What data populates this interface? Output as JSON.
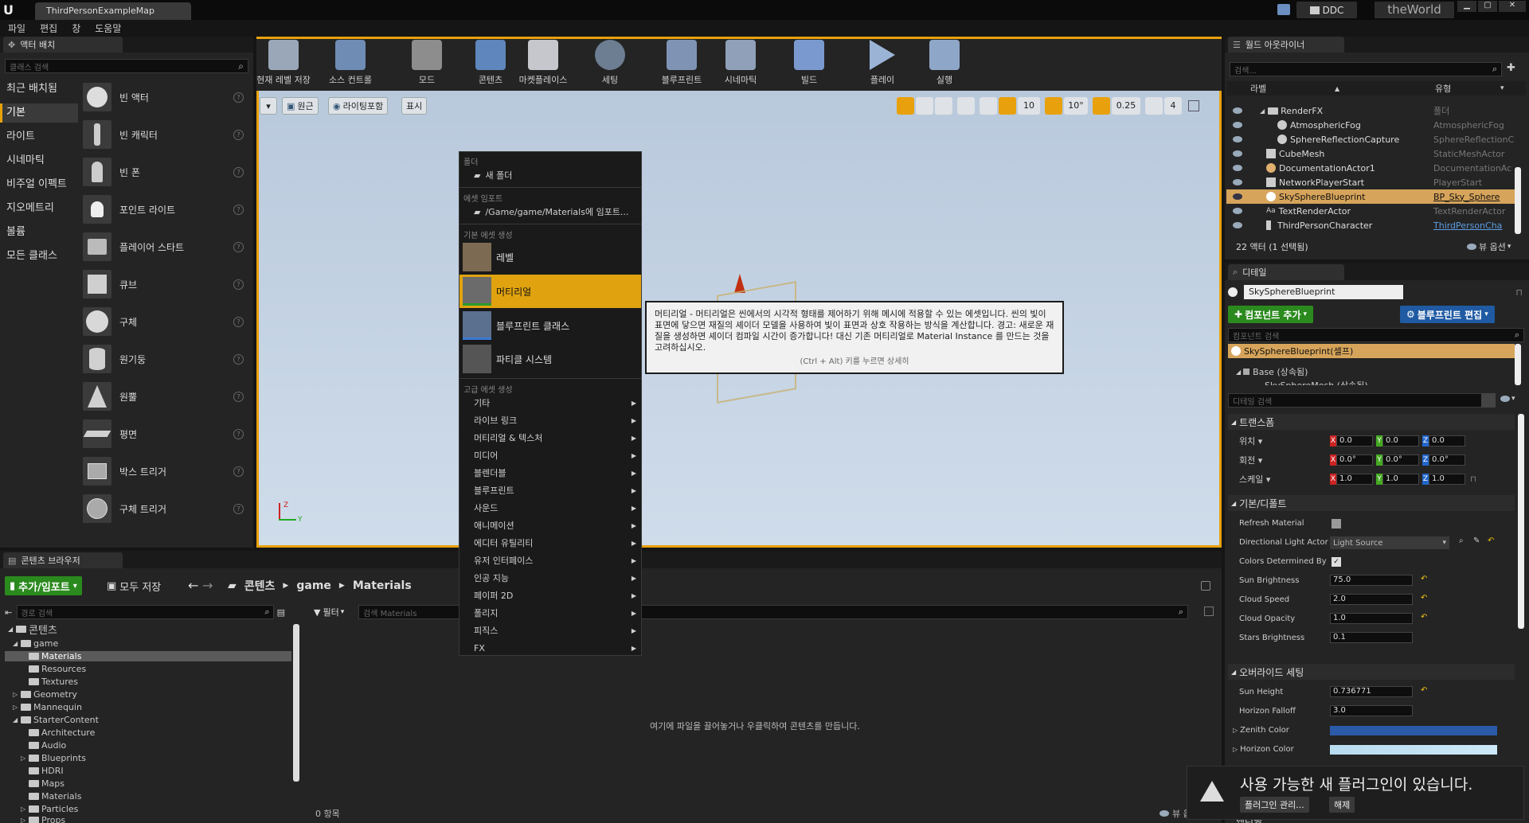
{
  "titlebar": {
    "tab_label": "ThirdPersonExampleMap",
    "ddc_label": "DDC",
    "world_label": "theWorld"
  },
  "menubar": [
    "파일",
    "편집",
    "창",
    "도움말"
  ],
  "place_panel": {
    "tab": "액터 배치",
    "search_placeholder": "클래스 검색",
    "categories": [
      "최근 배치됨",
      "기본",
      "라이트",
      "시네마틱",
      "비주얼 이펙트",
      "지오메트리",
      "볼륨",
      "모든 클래스"
    ],
    "selected_category": "기본",
    "items": [
      "빈 액터",
      "빈 캐릭터",
      "빈 폰",
      "포인트 라이트",
      "플레이어 스타트",
      "큐브",
      "구체",
      "원기둥",
      "원뿔",
      "평면",
      "박스 트리거",
      "구체 트리거"
    ],
    "help_glyph": "?"
  },
  "toolbar": {
    "buttons": [
      "현재 레벨 저장",
      "소스 컨트롤",
      "모드",
      "콘텐츠",
      "마켓플레이스",
      "세팅",
      "블루프린트",
      "시네마틱",
      "빌드",
      "플레이",
      "실행"
    ]
  },
  "viewport": {
    "chips": [
      "원근",
      "라이팅포함",
      "표시"
    ],
    "grid_snap": "10",
    "rot_snap": "10°",
    "scale_snap": "0.25",
    "cam_speed": "4"
  },
  "context_menu": {
    "sec_folder": "폴더",
    "new_folder": "새 폴더",
    "sec_import": "에셋 임포트",
    "import_path": "/Game/game/Materials에 임포트...",
    "sec_basic": "기본 에셋 생성",
    "basic_items": [
      "레벨",
      "머티리얼",
      "블루프린트 클래스",
      "파티클 시스템"
    ],
    "sec_advanced": "고급 에셋 생성",
    "advanced_items": [
      "기타",
      "라이브 링크",
      "머티리얼 & 텍스처",
      "미디어",
      "블렌더블",
      "블루프린트",
      "사운드",
      "애니메이션",
      "에디터 유틸리티",
      "유저 인터페이스",
      "인공 지능",
      "페이퍼 2D",
      "폴리지",
      "피직스",
      "FX"
    ]
  },
  "tooltip": {
    "text": "머티리얼 - 머티리얼은 씬에서의 시각적 형태를 제어하기 위해 메시에 적용할 수 있는 에셋입니다. 씬의 빛이 표면에 닿으면 재질의 셰이더 모델을 사용하여 빛이 표면과 상호 작용하는 방식을 계산합니다. 경고: 새로운 재질을 생성하면 셰이더 컴파일 시간이 증가합니다! 대신 기존 머티리얼로 Material Instance 를 만드는 것을 고려하십시오.",
    "hint": "(Ctrl + Alt) 키를 누르면 상세히"
  },
  "content_browser": {
    "tab": "콘텐츠 브라우저",
    "add_button": "추가/임포트",
    "save_all": "모두 저장",
    "breadcrumb": [
      "콘텐츠",
      "game",
      "Materials"
    ],
    "path_search_placeholder": "경로 검색",
    "filter_label": "필터",
    "asset_search_placeholder": "검색 Materials",
    "empty_hint": "여기에 파일을 끌어놓거나 우클릭하여 콘텐츠를 만듭니다.",
    "item_count": "0 항목",
    "view_options": "뷰 옵션",
    "tree": [
      {
        "label": "콘텐츠",
        "depth": 0,
        "open": true
      },
      {
        "label": "game",
        "depth": 1,
        "open": true
      },
      {
        "label": "Materials",
        "depth": 2,
        "selected": true
      },
      {
        "label": "Resources",
        "depth": 2
      },
      {
        "label": "Textures",
        "depth": 2
      },
      {
        "label": "Geometry",
        "depth": 1
      },
      {
        "label": "Mannequin",
        "depth": 1
      },
      {
        "label": "StarterContent",
        "depth": 1,
        "open": true
      },
      {
        "label": "Architecture",
        "depth": 2
      },
      {
        "label": "Audio",
        "depth": 2
      },
      {
        "label": "Blueprints",
        "depth": 2
      },
      {
        "label": "HDRI",
        "depth": 2
      },
      {
        "label": "Maps",
        "depth": 2
      },
      {
        "label": "Materials",
        "depth": 2
      },
      {
        "label": "Particles",
        "depth": 2
      },
      {
        "label": "Props",
        "depth": 2
      }
    ]
  },
  "outliner": {
    "tab": "월드 아웃라이너",
    "search_placeholder": "검색...",
    "col_label": "라벨",
    "col_type": "유형",
    "rows": [
      {
        "label": "RenderFX",
        "type": "폴더",
        "indent": 1
      },
      {
        "label": "AtmosphericFog",
        "type": "AtmosphericFog",
        "indent": 2
      },
      {
        "label": "SphereReflectionCapture",
        "type": "SphereReflectionC",
        "indent": 2
      },
      {
        "label": "CubeMesh",
        "type": "StaticMeshActor",
        "indent": 1
      },
      {
        "label": "DocumentationActor1",
        "type": "DocumentationAc",
        "indent": 1
      },
      {
        "label": "NetworkPlayerStart",
        "type": "PlayerStart",
        "indent": 1
      },
      {
        "label": "SkySphereBlueprint",
        "type": "BP_Sky_Sphere",
        "indent": 1,
        "selected": true
      },
      {
        "label": "TextRenderActor",
        "type": "TextRenderActor",
        "indent": 1
      },
      {
        "label": "ThirdPersonCharacter",
        "type": "ThirdPersonCha",
        "indent": 1
      }
    ],
    "footer": "22 액터 (1 선택됨)",
    "view_options": "뷰 옵션"
  },
  "details": {
    "tab": "디테일",
    "object_name": "SkySphereBlueprint",
    "add_component": "컴포넌트 추가",
    "edit_blueprint": "블루프린트 편집",
    "component_search_placeholder": "컴포넌트 검색",
    "self_component": "SkySphereBlueprint(셀프)",
    "base_component": "Base (상속됨)",
    "base_child": "SkySphereMesh (상속됨)",
    "details_search_placeholder": "디테일 검색",
    "transform": {
      "title": "트랜스폼",
      "rows": [
        {
          "label": "위치",
          "x": "0.0",
          "y": "0.0",
          "z": "0.0"
        },
        {
          "label": "회전",
          "x": "0.0°",
          "y": "0.0°",
          "z": "0.0°"
        },
        {
          "label": "스케일",
          "x": "1.0",
          "y": "1.0",
          "z": "1.0"
        }
      ]
    },
    "default_section": {
      "title": "기본/디폴트",
      "refresh_material": "Refresh Material",
      "directional_light_label": "Directional Light Actor",
      "directional_light_value": "Light Source",
      "colors_determined_label": "Colors Determined By",
      "sun_brightness_label": "Sun Brightness",
      "sun_brightness": "75.0",
      "cloud_speed_label": "Cloud Speed",
      "cloud_speed": "2.0",
      "cloud_opacity_label": "Cloud Opacity",
      "cloud_opacity": "1.0",
      "stars_brightness_label": "Stars Brightness",
      "stars_brightness": "0.1"
    },
    "override_section": {
      "title": "오버라이드 세팅",
      "sun_height_label": "Sun Height",
      "sun_height": "0.736771",
      "horizon_falloff_label": "Horizon Falloff",
      "horizon_falloff": "3.0",
      "zenith_color_label": "Zenith Color",
      "horizon_color_label": "Horizon Color"
    },
    "bottom_section": "렌더링"
  },
  "notification": {
    "title": "사용 가능한 새 플러그인이 있습니다.",
    "manage_button": "플러그인 관리...",
    "dismiss_button": "해제"
  },
  "colors": {
    "accent_orange": "#e8a10c",
    "selected_row": "#d6a45a",
    "green": "#2b8a1e",
    "blue": "#1f5aa3"
  }
}
